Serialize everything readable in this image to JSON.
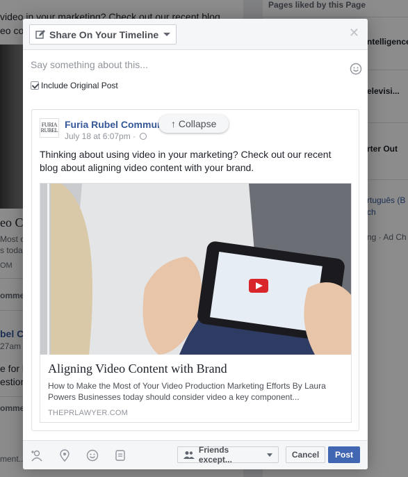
{
  "background": {
    "left_post_text": "video in your marketing? Check out our recent blog",
    "left_post_text2": "eo co",
    "left_title_fragment": "eo C",
    "left_desc_1": "Most of",
    "left_desc_2": "s toda",
    "left_domain": "OM",
    "left_comment": "ommen",
    "left_page": "bel Co",
    "left_time": "27am",
    "left_text_1": "e for b",
    "left_text_2": "estions",
    "left_comment2": "ommen",
    "left_input": "ment...",
    "right_header": "Pages liked by this Page",
    "right_item_1": "ntelligence",
    "right_item_2": "elevisi...",
    "right_item_3": "rter Out",
    "right_lang": "rtuguês (B",
    "right_lang2": "ch",
    "right_footer": "ng · Ad Ch"
  },
  "dialog": {
    "share_label": "Share On Your Timeline",
    "close_icon": "close-icon",
    "say_placeholder": "Say something about this...",
    "include_label": "Include Original Post",
    "include_checked": true
  },
  "card": {
    "avatar_line1": "FURIA",
    "avatar_line2": "RUBEL",
    "page_name": "Furia Rubel Communications",
    "timestamp": "July 18 at 6:07pm",
    "collapse_label": "↑ Collapse",
    "post_text": "Thinking about using video in your marketing? Check out our recent blog about aligning video content with your brand.",
    "link_title": "Aligning Video Content with Brand",
    "link_desc": "How to Make the Most of Your Video Production Marketing Efforts By Laura Powers Businesses today should consider video a key component...",
    "link_domain": "THEPRLAWYER.COM"
  },
  "footer": {
    "icons": [
      "tag-people-icon",
      "location-icon",
      "feeling-icon",
      "sticker-icon"
    ],
    "audience_label": "Friends except...",
    "cancel_label": "Cancel",
    "post_label": "Post"
  },
  "colors": {
    "brand_blue": "#4267b2",
    "link_blue": "#365899"
  }
}
